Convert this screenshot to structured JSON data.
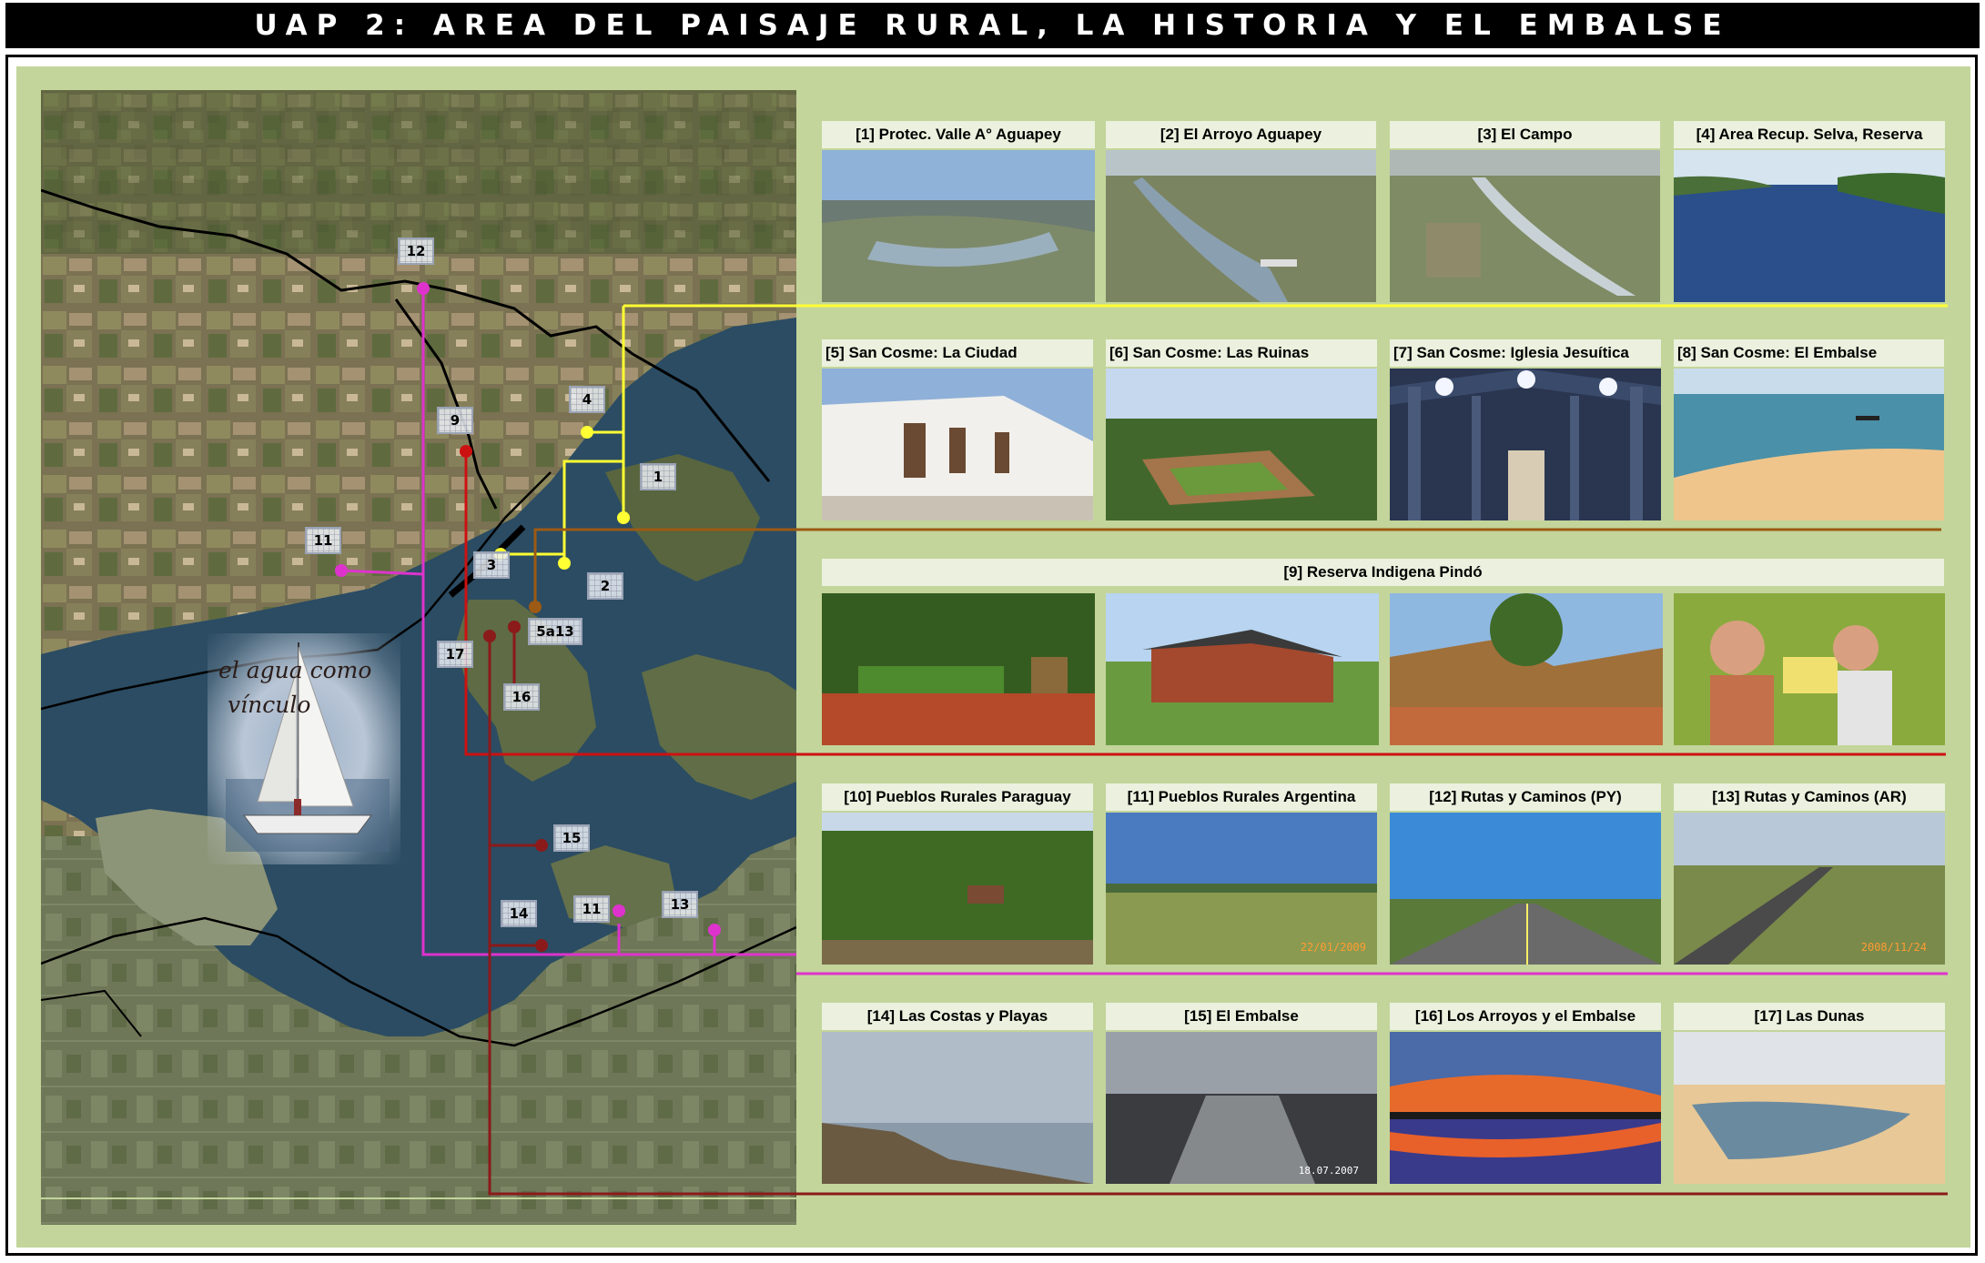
{
  "title": "UAP 2: AREA DEL PAISAJE RURAL, LA HISTORIA Y EL EMBALSE",
  "colors": {
    "background": "#c3d59b",
    "label_bg": "#ebf1de",
    "yellow_route": "#ffff33",
    "magenta_route": "#dd33cc",
    "red_route": "#cc1111",
    "darkred_route": "#8b1a1a",
    "brown_route": "#9c5a14"
  },
  "map": {
    "markers": [
      "12",
      "9",
      "4",
      "1",
      "11",
      "3",
      "2",
      "5a13",
      "17",
      "16",
      "15",
      "14",
      "11",
      "13"
    ],
    "inset": {
      "caption_line1": "el agua como",
      "caption_line2": "vínculo"
    }
  },
  "photos": {
    "row1": [
      "[1] Protec. Valle A° Aguapey",
      "[2] El Arroyo Aguapey",
      "[3] El Campo",
      "[4] Area Recup. Selva, Reserva"
    ],
    "row2": [
      "[5] San Cosme: La Ciudad",
      "[6] San Cosme: Las Ruinas",
      "[7] San Cosme: Iglesia Jesuítica",
      "[8] San Cosme: El Embalse"
    ],
    "row3": [
      "[9] Reserva Indigena Pindó"
    ],
    "row4": [
      "[10] Pueblos Rurales Paraguay",
      "[11] Pueblos Rurales Argentina",
      "[12] Rutas y Caminos (PY)",
      "[13] Rutas y Caminos (AR)"
    ],
    "row5": [
      "[14] Las Costas y Playas",
      "[15] El Embalse",
      "[16] Los Arroyos y el Embalse",
      "[17] Las Dunas"
    ],
    "stamps": {
      "p11": "22/01/2009",
      "p13": "2008/11/24",
      "p15": "18.07.2007"
    }
  }
}
